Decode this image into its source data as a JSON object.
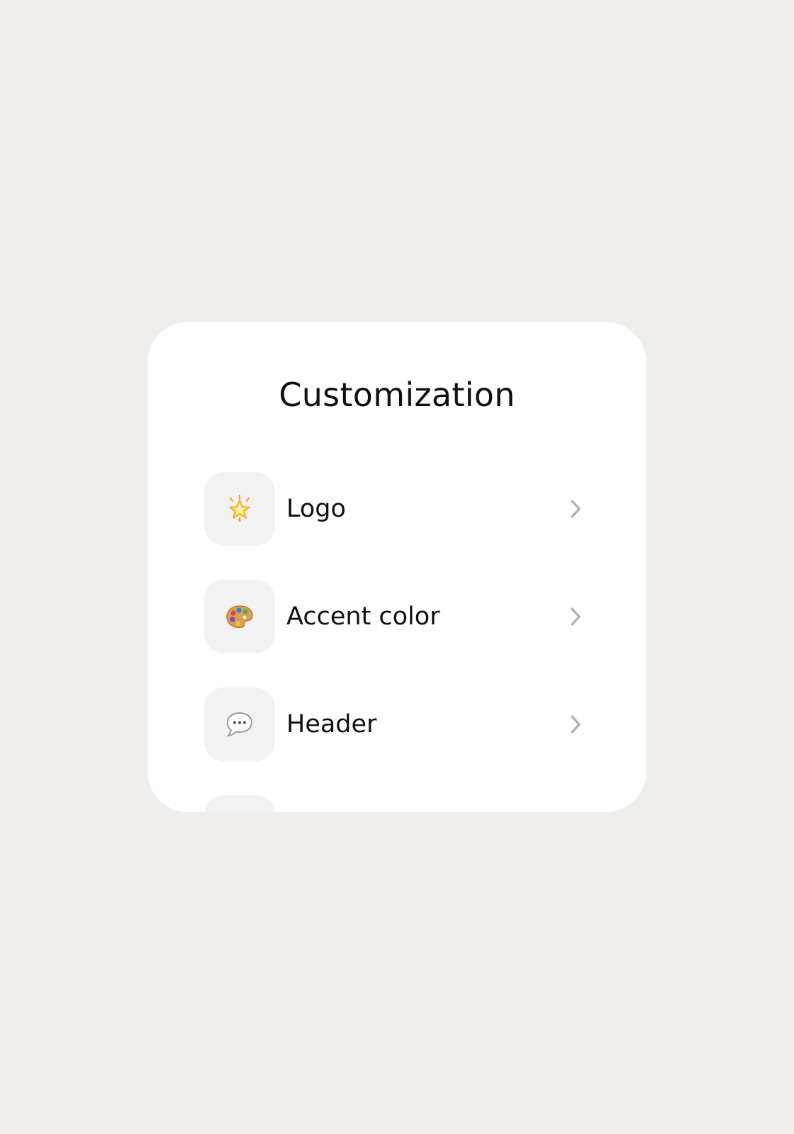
{
  "card": {
    "title": "Customization"
  },
  "items": [
    {
      "label": "Logo",
      "icon": "glowing-star-icon"
    },
    {
      "label": "Accent color",
      "icon": "palette-icon"
    },
    {
      "label": "Header",
      "icon": "speech-bubble-icon"
    },
    {
      "label": "",
      "icon": ""
    }
  ],
  "colors": {
    "background": "#efeeeb",
    "card": "#ffffff",
    "icon_box": "#f2f2f3",
    "chevron": "#b0b0b0",
    "text": "#111111"
  }
}
